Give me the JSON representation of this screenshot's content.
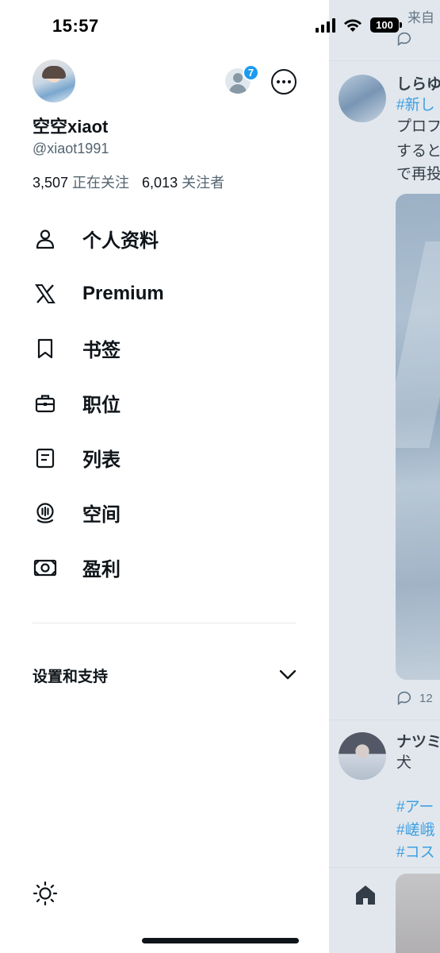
{
  "status_bar": {
    "time": "15:57",
    "battery": "100"
  },
  "profile": {
    "display_name": "空空xiaot",
    "handle": "@xiaot1991",
    "following_count": "3,507",
    "following_label": "正在关注",
    "followers_count": "6,013",
    "followers_label": "关注者",
    "switch_account_badge": "7"
  },
  "menu": {
    "items": [
      {
        "label": "个人资料",
        "icon": "person-icon"
      },
      {
        "label": "Premium",
        "icon": "x-logo-icon"
      },
      {
        "label": "书签",
        "icon": "bookmark-icon"
      },
      {
        "label": "职位",
        "icon": "briefcase-icon"
      },
      {
        "label": "列表",
        "icon": "list-icon"
      },
      {
        "label": "空间",
        "icon": "spaces-icon"
      },
      {
        "label": "盈利",
        "icon": "monetization-icon"
      }
    ]
  },
  "settings": {
    "label": "设置和支持",
    "icon": "chevron-down-icon"
  },
  "theme": {
    "icon": "sun-icon"
  },
  "timeline": {
    "from_label": "来自",
    "post1": {
      "name": "しらゆ",
      "lines": [
        "#新し",
        "プロフ",
        "すると",
        "で再投"
      ],
      "reply_count": "12"
    },
    "post2": {
      "name": "ナツミ",
      "lines": [
        "犬",
        "",
        "#アー",
        "#嵯峨",
        "#コス"
      ]
    }
  },
  "colors": {
    "accent": "#1d9bf0",
    "text_primary": "#0f1419",
    "text_secondary": "#536471"
  }
}
